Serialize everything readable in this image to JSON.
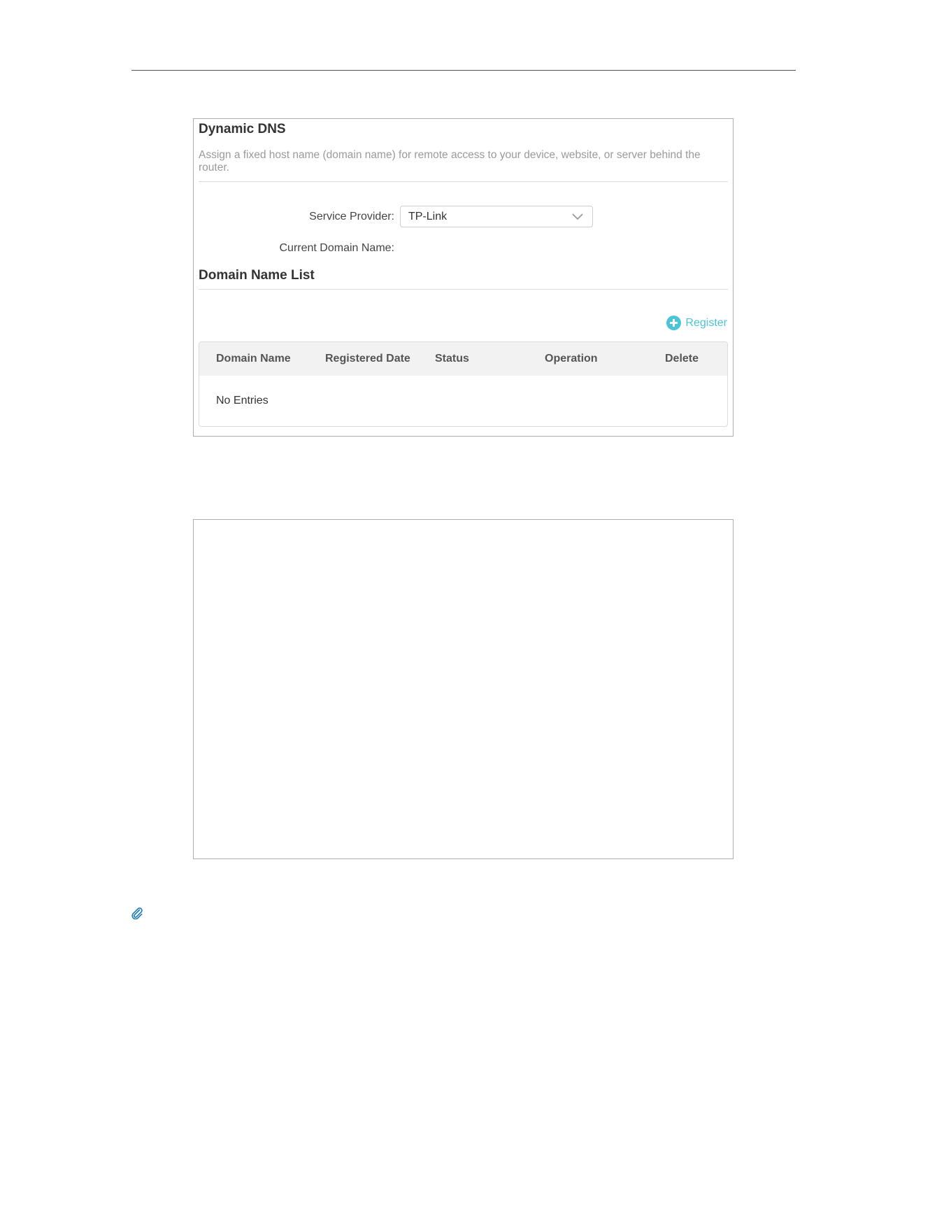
{
  "panel": {
    "title": "Dynamic DNS",
    "description": "Assign a fixed host name (domain name) for remote access to your device, website, or server behind the router."
  },
  "form": {
    "service_provider_label": "Service Provider:",
    "service_provider_value": "TP-Link",
    "current_domain_label": "Current Domain Name:"
  },
  "domain_list": {
    "title": "Domain Name List",
    "register_label": "Register",
    "columns": [
      "Domain Name",
      "Registered Date",
      "Status",
      "Operation",
      "Delete"
    ],
    "empty_text": "No Entries"
  },
  "colors": {
    "accent": "#4cc4d8",
    "muted_text": "#9a9a9a",
    "table_header_bg": "#f2f2f2"
  },
  "icons": {
    "dropdown": "chevron-down-icon",
    "register": "plus-circle-icon",
    "note": "paperclip-icon"
  }
}
